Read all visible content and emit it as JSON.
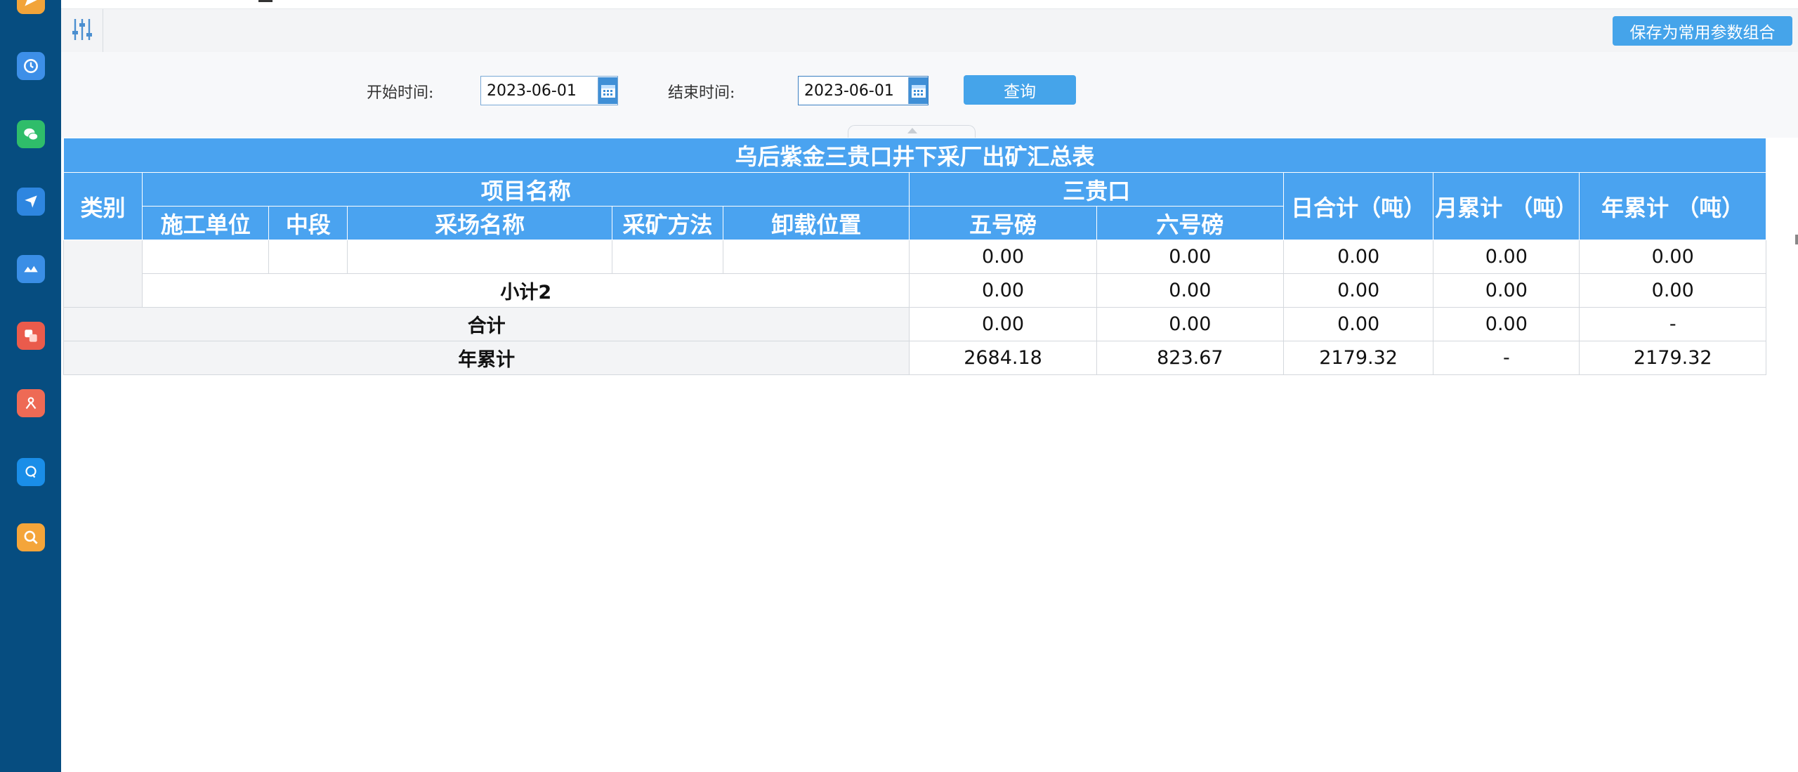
{
  "toolbar": {
    "save_combo_label": "保存为常用参数组合"
  },
  "filter": {
    "start_label": "开始时间:",
    "start_value": "2023-06-01",
    "end_label": "结束时间:",
    "end_value": "2023-06-01",
    "query_label": "查询"
  },
  "report": {
    "title": "乌后紫金三贵口井下采厂出矿汇总表",
    "headers": {
      "category": "类别",
      "project_name": "项目名称",
      "sanguikou": "三贵口",
      "daily_total": "日合计（吨）",
      "monthly_total": "月累计 （吨）",
      "yearly_total": "年累计 （吨）",
      "construction_unit": "施工单位",
      "mid_section": "中段",
      "stope_name": "采场名称",
      "mining_method": "采矿方法",
      "unload_position": "卸载位置",
      "scale_5": "五号磅",
      "scale_6": "六号磅"
    },
    "rows": {
      "detail": {
        "scale_5": "0.00",
        "scale_6": "0.00",
        "daily": "0.00",
        "monthly": "0.00",
        "yearly": "0.00"
      },
      "subtotal": {
        "label": "小计2",
        "scale_5": "0.00",
        "scale_6": "0.00",
        "daily": "0.00",
        "monthly": "0.00",
        "yearly": "0.00"
      },
      "total": {
        "label": "合计",
        "scale_5": "0.00",
        "scale_6": "0.00",
        "daily": "0.00",
        "monthly": "0.00",
        "yearly": "-"
      },
      "year_total": {
        "label": "年累计",
        "scale_5": "2684.18",
        "scale_6": "823.67",
        "daily": "2179.32",
        "monthly": "-",
        "yearly": "2179.32"
      }
    }
  },
  "colors": {
    "dock": "#064d80",
    "accent": "#45a4ea",
    "header": "#4aa3f0"
  },
  "dock_icons": [
    "send-icon",
    "clock-icon",
    "wechat-icon",
    "navigation-icon",
    "cloud-icon",
    "translate-icon",
    "pdf-icon",
    "q-icon",
    "search-icon"
  ]
}
